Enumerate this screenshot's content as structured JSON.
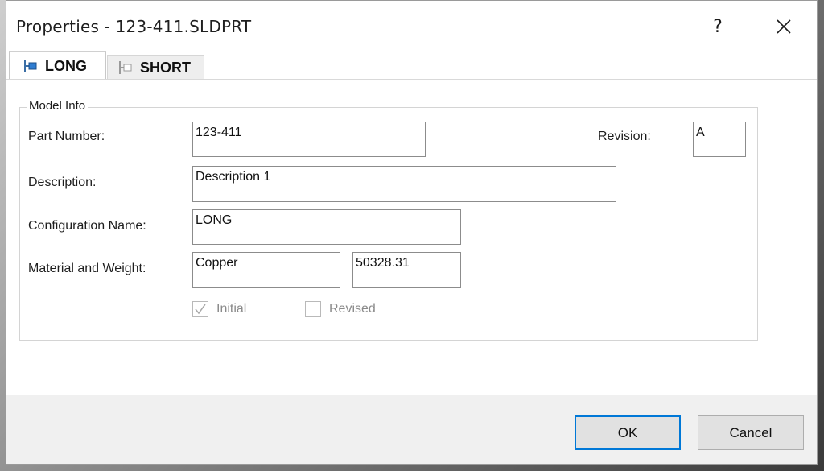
{
  "window": {
    "title": "Properties - 123-411.SLDPRT",
    "help_label": "?"
  },
  "tabs": [
    {
      "label": "LONG",
      "icon": "configuration-icon",
      "active": true
    },
    {
      "label": "SHORT",
      "icon": "configuration-icon",
      "active": false
    }
  ],
  "model_info": {
    "group_title": "Model Info",
    "part_number": {
      "label": "Part Number:",
      "value": "123-411"
    },
    "revision": {
      "label": "Revision:",
      "value": "A"
    },
    "description": {
      "label": "Description:",
      "value": "Description 1"
    },
    "configuration_name": {
      "label": "Configuration Name:",
      "value": "LONG"
    },
    "material_weight": {
      "label": "Material and Weight:",
      "material": "Copper",
      "weight": "50328.31"
    },
    "checkboxes": [
      {
        "label": "Initial",
        "checked": true,
        "disabled": true
      },
      {
        "label": "Revised",
        "checked": false,
        "disabled": true
      }
    ]
  },
  "buttons": {
    "ok": "OK",
    "cancel": "Cancel"
  },
  "colors": {
    "accent": "#0078d7",
    "footer_bg": "#f0f0f0"
  }
}
